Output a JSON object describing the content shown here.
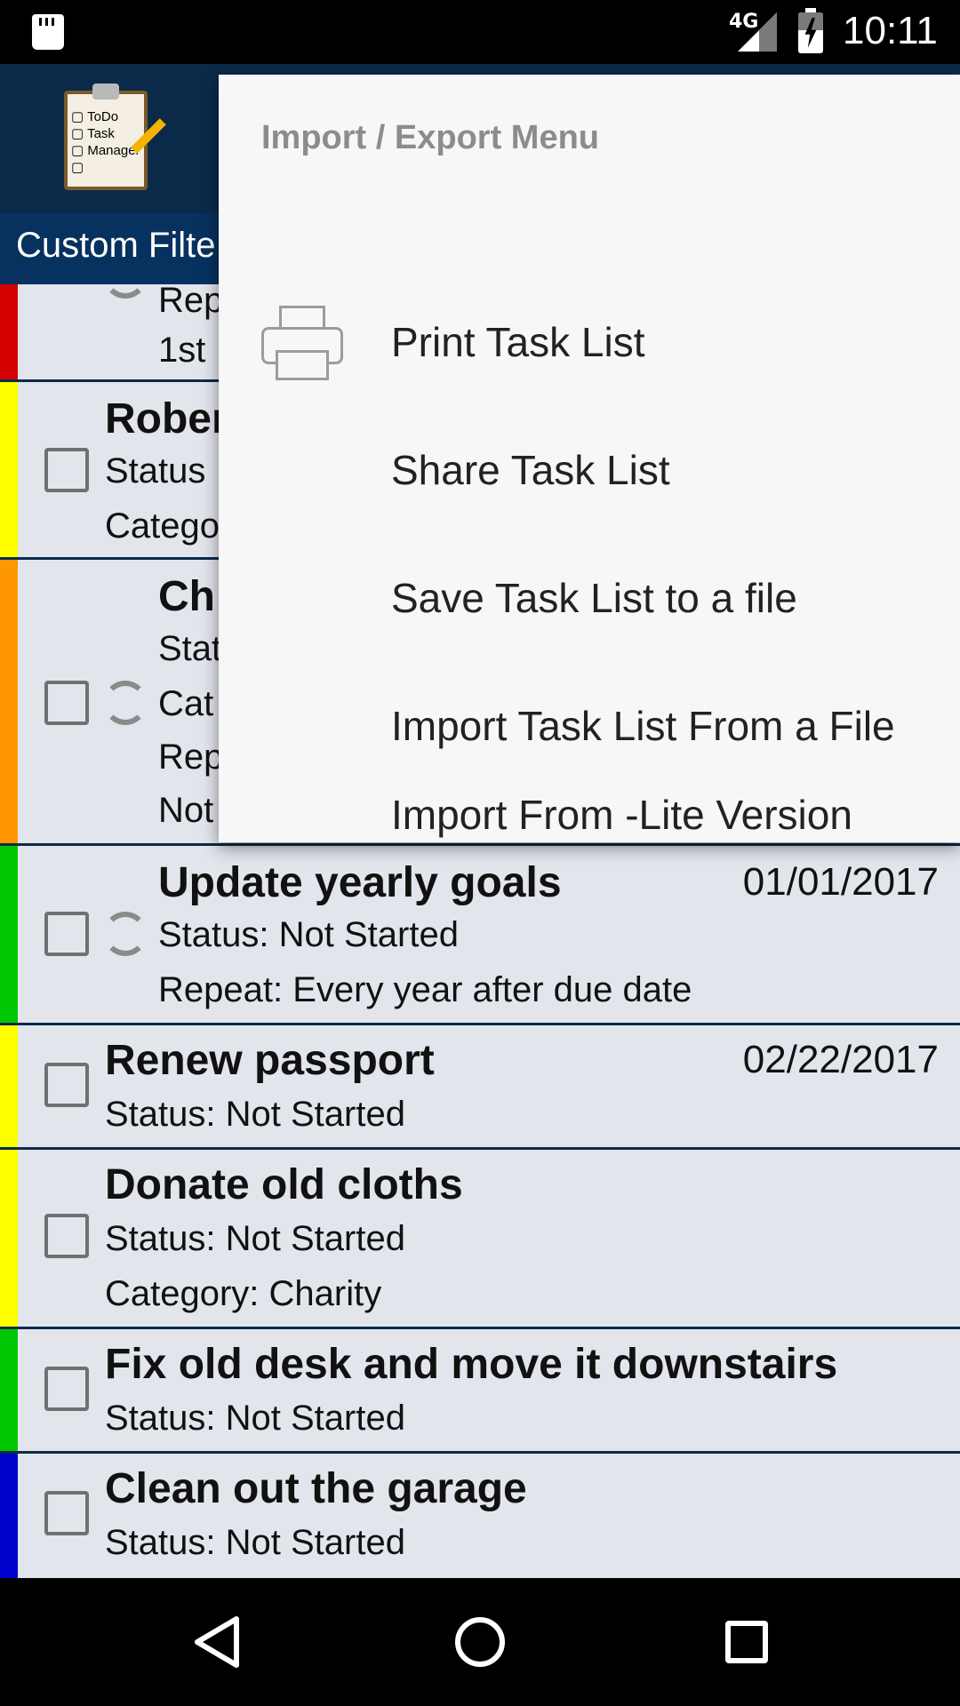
{
  "status_bar": {
    "network": "4G",
    "time": "10:11"
  },
  "app_bar": {
    "logo_lines": [
      "ToDo",
      "Task",
      "Manager"
    ],
    "filter_label": "Custom Filte"
  },
  "tasks": [
    {
      "color": "#d50000",
      "title": "",
      "date": "",
      "lines": [
        "Rep",
        "1st"
      ],
      "has_checkbox": false,
      "repeat": true
    },
    {
      "color": "#ffff00",
      "title": "Rober",
      "date": "",
      "lines": [
        "Status",
        "Catego"
      ],
      "has_checkbox": true,
      "repeat": false
    },
    {
      "color": "#ff9800",
      "title": "Ch",
      "date": "",
      "lines": [
        "Stat",
        "Cat",
        "Rep",
        "Not"
      ],
      "has_checkbox": true,
      "repeat": true
    },
    {
      "color": "#00c800",
      "title": "Update yearly goals",
      "date": "01/01/2017",
      "lines": [
        "Status: Not Started",
        "Repeat: Every year after due date"
      ],
      "has_checkbox": true,
      "repeat": true
    },
    {
      "color": "#ffff00",
      "title": "Renew passport",
      "date": "02/22/2017",
      "lines": [
        "Status: Not Started"
      ],
      "has_checkbox": true,
      "repeat": false
    },
    {
      "color": "#ffff00",
      "title": "Donate old cloths",
      "date": "",
      "lines": [
        "Status: Not Started",
        "Category: Charity"
      ],
      "has_checkbox": true,
      "repeat": false
    },
    {
      "color": "#00c800",
      "title": "Fix old desk and move it downstairs",
      "date": "",
      "lines": [
        "Status: Not Started"
      ],
      "has_checkbox": true,
      "repeat": false
    },
    {
      "color": "#0000cc",
      "title": "Clean out the garage",
      "date": "",
      "lines": [
        "Status: Not Started"
      ],
      "has_checkbox": true,
      "repeat": false
    }
  ],
  "menu": {
    "title": "Import / Export Menu",
    "items": [
      {
        "label": "Print Task List",
        "icon": "printer-icon"
      },
      {
        "label": "Share Task List"
      },
      {
        "label": "Save Task List to a file"
      },
      {
        "label": "Import Task List From a File"
      },
      {
        "label": "Import From -Lite Version"
      }
    ]
  }
}
